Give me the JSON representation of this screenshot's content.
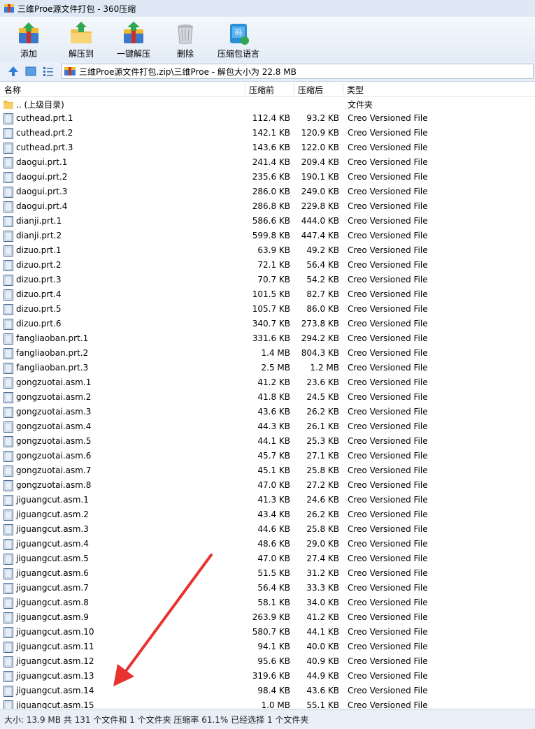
{
  "window": {
    "title": "三维Proe源文件打包 - 360压缩"
  },
  "toolbar": {
    "buttons": [
      {
        "label": "添加",
        "icon": "add-archive-icon"
      },
      {
        "label": "解压到",
        "icon": "extract-to-icon"
      },
      {
        "label": "一键解压",
        "icon": "one-click-extract-icon"
      },
      {
        "label": "删除",
        "icon": "delete-trash-icon"
      },
      {
        "label": "压缩包语言",
        "icon": "archive-language-icon"
      }
    ]
  },
  "address": {
    "path": "三维Proe源文件打包.zip\\三维Proe - 解包大小为 22.8 MB"
  },
  "columns": {
    "name": "名称",
    "size": "压缩前",
    "compressed": "压缩后",
    "type": "类型"
  },
  "files": [
    {
      "name": ".. (上级目录)",
      "size": "",
      "compressed": "",
      "type": "文件夹",
      "icon": "folder"
    },
    {
      "name": "cuthead.prt.1",
      "size": "112.4 KB",
      "compressed": "93.2 KB",
      "type": "Creo Versioned File"
    },
    {
      "name": "cuthead.prt.2",
      "size": "142.1 KB",
      "compressed": "120.9 KB",
      "type": "Creo Versioned File"
    },
    {
      "name": "cuthead.prt.3",
      "size": "143.6 KB",
      "compressed": "122.0 KB",
      "type": "Creo Versioned File"
    },
    {
      "name": "daogui.prt.1",
      "size": "241.4 KB",
      "compressed": "209.4 KB",
      "type": "Creo Versioned File"
    },
    {
      "name": "daogui.prt.2",
      "size": "235.6 KB",
      "compressed": "190.1 KB",
      "type": "Creo Versioned File"
    },
    {
      "name": "daogui.prt.3",
      "size": "286.0 KB",
      "compressed": "249.0 KB",
      "type": "Creo Versioned File"
    },
    {
      "name": "daogui.prt.4",
      "size": "286.8 KB",
      "compressed": "229.8 KB",
      "type": "Creo Versioned File"
    },
    {
      "name": "dianji.prt.1",
      "size": "586.6 KB",
      "compressed": "444.0 KB",
      "type": "Creo Versioned File"
    },
    {
      "name": "dianji.prt.2",
      "size": "599.8 KB",
      "compressed": "447.4 KB",
      "type": "Creo Versioned File"
    },
    {
      "name": "dizuo.prt.1",
      "size": "63.9 KB",
      "compressed": "49.2 KB",
      "type": "Creo Versioned File"
    },
    {
      "name": "dizuo.prt.2",
      "size": "72.1 KB",
      "compressed": "56.4 KB",
      "type": "Creo Versioned File"
    },
    {
      "name": "dizuo.prt.3",
      "size": "70.7 KB",
      "compressed": "54.2 KB",
      "type": "Creo Versioned File"
    },
    {
      "name": "dizuo.prt.4",
      "size": "101.5 KB",
      "compressed": "82.7 KB",
      "type": "Creo Versioned File"
    },
    {
      "name": "dizuo.prt.5",
      "size": "105.7 KB",
      "compressed": "86.0 KB",
      "type": "Creo Versioned File"
    },
    {
      "name": "dizuo.prt.6",
      "size": "340.7 KB",
      "compressed": "273.8 KB",
      "type": "Creo Versioned File"
    },
    {
      "name": "fangliaoban.prt.1",
      "size": "331.6 KB",
      "compressed": "294.2 KB",
      "type": "Creo Versioned File"
    },
    {
      "name": "fangliaoban.prt.2",
      "size": "1.4 MB",
      "compressed": "804.3 KB",
      "type": "Creo Versioned File"
    },
    {
      "name": "fangliaoban.prt.3",
      "size": "2.5 MB",
      "compressed": "1.2 MB",
      "type": "Creo Versioned File"
    },
    {
      "name": "gongzuotai.asm.1",
      "size": "41.2 KB",
      "compressed": "23.6 KB",
      "type": "Creo Versioned File"
    },
    {
      "name": "gongzuotai.asm.2",
      "size": "41.8 KB",
      "compressed": "24.5 KB",
      "type": "Creo Versioned File"
    },
    {
      "name": "gongzuotai.asm.3",
      "size": "43.6 KB",
      "compressed": "26.2 KB",
      "type": "Creo Versioned File"
    },
    {
      "name": "gongzuotai.asm.4",
      "size": "44.3 KB",
      "compressed": "26.1 KB",
      "type": "Creo Versioned File"
    },
    {
      "name": "gongzuotai.asm.5",
      "size": "44.1 KB",
      "compressed": "25.3 KB",
      "type": "Creo Versioned File"
    },
    {
      "name": "gongzuotai.asm.6",
      "size": "45.7 KB",
      "compressed": "27.1 KB",
      "type": "Creo Versioned File"
    },
    {
      "name": "gongzuotai.asm.7",
      "size": "45.1 KB",
      "compressed": "25.8 KB",
      "type": "Creo Versioned File"
    },
    {
      "name": "gongzuotai.asm.8",
      "size": "47.0 KB",
      "compressed": "27.2 KB",
      "type": "Creo Versioned File"
    },
    {
      "name": "jiguangcut.asm.1",
      "size": "41.3 KB",
      "compressed": "24.6 KB",
      "type": "Creo Versioned File"
    },
    {
      "name": "jiguangcut.asm.2",
      "size": "43.4 KB",
      "compressed": "26.2 KB",
      "type": "Creo Versioned File"
    },
    {
      "name": "jiguangcut.asm.3",
      "size": "44.6 KB",
      "compressed": "25.8 KB",
      "type": "Creo Versioned File"
    },
    {
      "name": "jiguangcut.asm.4",
      "size": "48.6 KB",
      "compressed": "29.0 KB",
      "type": "Creo Versioned File"
    },
    {
      "name": "jiguangcut.asm.5",
      "size": "47.0 KB",
      "compressed": "27.4 KB",
      "type": "Creo Versioned File"
    },
    {
      "name": "jiguangcut.asm.6",
      "size": "51.5 KB",
      "compressed": "31.2 KB",
      "type": "Creo Versioned File"
    },
    {
      "name": "jiguangcut.asm.7",
      "size": "56.4 KB",
      "compressed": "33.3 KB",
      "type": "Creo Versioned File"
    },
    {
      "name": "jiguangcut.asm.8",
      "size": "58.1 KB",
      "compressed": "34.0 KB",
      "type": "Creo Versioned File"
    },
    {
      "name": "jiguangcut.asm.9",
      "size": "263.9 KB",
      "compressed": "41.2 KB",
      "type": "Creo Versioned File"
    },
    {
      "name": "jiguangcut.asm.10",
      "size": "580.7 KB",
      "compressed": "44.1 KB",
      "type": "Creo Versioned File"
    },
    {
      "name": "jiguangcut.asm.11",
      "size": "94.1 KB",
      "compressed": "40.0 KB",
      "type": "Creo Versioned File"
    },
    {
      "name": "jiguangcut.asm.12",
      "size": "95.6 KB",
      "compressed": "40.9 KB",
      "type": "Creo Versioned File"
    },
    {
      "name": "jiguangcut.asm.13",
      "size": "319.6 KB",
      "compressed": "44.9 KB",
      "type": "Creo Versioned File"
    },
    {
      "name": "jiguangcut.asm.14",
      "size": "98.4 KB",
      "compressed": "43.6 KB",
      "type": "Creo Versioned File"
    },
    {
      "name": "jiguangcut.asm.15",
      "size": "1.0 MB",
      "compressed": "55.1 KB",
      "type": "Creo Versioned File"
    }
  ],
  "status": {
    "text": "大小: 13.9 MB 共 131 个文件和 1 个文件夹 压缩率 61.1% 已经选择 1 个文件夹"
  },
  "colors": {
    "annotation_arrow": "#e8322f",
    "toolbar_bg": "#e3ecf7"
  }
}
